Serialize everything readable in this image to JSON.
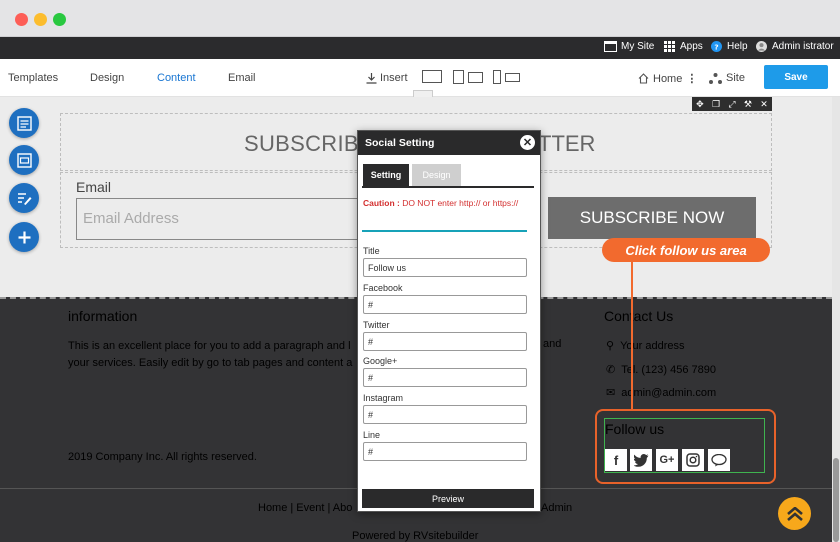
{
  "admin_bar": {
    "my_site": "My Site",
    "apps": "Apps",
    "help": "Help",
    "user": "Admin istrator"
  },
  "toolbar": {
    "templates": "Templates",
    "design": "Design",
    "content": "Content",
    "email": "Email",
    "insert": "Insert",
    "home": "Home",
    "site": "Site",
    "save": "Save"
  },
  "subscribe": {
    "title_left": "SUBSCRIB",
    "title_right": "TTER",
    "email_label": "Email",
    "email_placeholder": "Email Address",
    "button": "SUBSCRIBE NOW"
  },
  "modal": {
    "title": "Social Setting",
    "tab_setting": "Setting",
    "tab_design": "Design",
    "caution_label": "Caution :",
    "caution_text": " DO NOT enter http:// or https://",
    "fields": [
      {
        "label": "Title",
        "value": "Follow us"
      },
      {
        "label": "Facebook",
        "value": "#"
      },
      {
        "label": "Twitter",
        "value": "#"
      },
      {
        "label": "Google+",
        "value": "#"
      },
      {
        "label": "Instagram",
        "value": "#"
      },
      {
        "label": "Line",
        "value": "#"
      }
    ],
    "preview": "Preview"
  },
  "footer": {
    "info_title": "information",
    "info_text": "This is an excellent place for you to add a paragraph and l",
    "info_text_2": "your services. Easily edit by go to tab pages and content a",
    "info_text_end": "and",
    "copyright": "2019 Company Inc. All rights reserved.",
    "contact_title": "Contact Us",
    "address": "Your address",
    "phone": "Tel. (123) 456 7890",
    "email": "admin@admin.com",
    "follow_title": "Follow us",
    "menu": "Home | Event | Abo",
    "menu_admin": "Admin",
    "powered": "Powered by RVsitebuilder"
  },
  "annotation": {
    "callout": "Click follow us area",
    "color": "#f26a2e"
  },
  "colors": {
    "accent": "#1e9be9",
    "fab": "#1e6fc0",
    "follow_border": "#3fb34f",
    "caution": "#d32f2f"
  },
  "icons": {
    "social": [
      "facebook-icon",
      "twitter-icon",
      "google-plus-icon",
      "instagram-icon",
      "line-icon"
    ]
  }
}
